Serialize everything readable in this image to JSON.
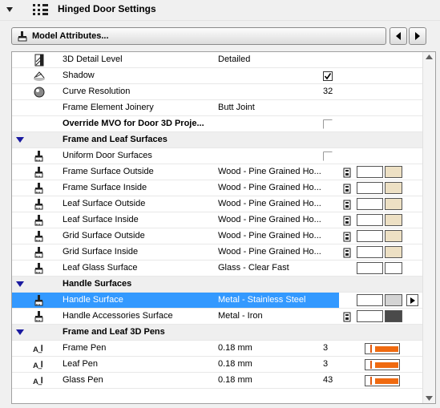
{
  "header": {
    "title": "Hinged Door Settings",
    "icon": "settings-grid-icon"
  },
  "toolbar": {
    "model_label": "Model Attributes..."
  },
  "colors": {
    "selection": "#3399ff",
    "pen": "#f06a10",
    "wood": "#ede0c4",
    "gray": "#d4d4d4",
    "iron": "#4a4a4a"
  },
  "rows": [
    {
      "type": "item",
      "icon": "detail-level-icon",
      "name": "3D Detail Level",
      "value": "Detailed"
    },
    {
      "type": "item",
      "icon": "shadow-icon",
      "name": "Shadow",
      "checked": true
    },
    {
      "type": "item",
      "icon": "sphere-icon",
      "name": "Curve Resolution",
      "num": "32"
    },
    {
      "type": "item",
      "icon": "",
      "name": "Frame Element Joinery",
      "value": "Butt Joint"
    },
    {
      "type": "item",
      "icon": "",
      "name": "Override MVO for Door 3D Proje...",
      "bold": true,
      "checked": false
    },
    {
      "type": "group",
      "name": "Frame and Leaf Surfaces"
    },
    {
      "type": "item",
      "icon": "paint-brush-icon",
      "name": "Uniform Door Surfaces",
      "checked": false
    },
    {
      "type": "item",
      "icon": "paint-brush-icon",
      "name": "Frame Surface Outside",
      "value": "Wood - Pine Grained Ho...",
      "swatch": "wood"
    },
    {
      "type": "item",
      "icon": "paint-brush-icon",
      "name": "Frame Surface Inside",
      "value": "Wood - Pine Grained Ho...",
      "swatch": "wood"
    },
    {
      "type": "item",
      "icon": "paint-brush-icon",
      "name": "Leaf Surface Outside",
      "value": "Wood - Pine Grained Ho...",
      "swatch": "wood"
    },
    {
      "type": "item",
      "icon": "paint-brush-icon",
      "name": "Leaf Surface Inside",
      "value": "Wood - Pine Grained Ho...",
      "swatch": "wood"
    },
    {
      "type": "item",
      "icon": "paint-brush-icon",
      "name": "Grid Surface Outside",
      "value": "Wood - Pine Grained Ho...",
      "swatch": "wood"
    },
    {
      "type": "item",
      "icon": "paint-brush-icon",
      "name": "Grid Surface Inside",
      "value": "Wood - Pine Grained Ho...",
      "swatch": "wood"
    },
    {
      "type": "item",
      "icon": "paint-brush-icon",
      "name": "Leaf Glass Surface",
      "value": "Glass - Clear Fast",
      "swatch": "glass"
    },
    {
      "type": "group",
      "name": "Handle Surfaces"
    },
    {
      "type": "item",
      "icon": "paint-brush-icon",
      "name": "Handle Surface",
      "value": "Metal - Stainless Steel",
      "swatch": "gray",
      "selected": true
    },
    {
      "type": "item",
      "icon": "paint-brush-icon",
      "name": "Handle Accessories Surface",
      "value": "Metal - Iron",
      "swatch": "iron"
    },
    {
      "type": "group",
      "name": "Frame and Leaf 3D Pens"
    },
    {
      "type": "item",
      "icon": "pen-icon",
      "name": "Frame Pen",
      "value": "0.18 mm",
      "num": "3",
      "pen": true
    },
    {
      "type": "item",
      "icon": "pen-icon",
      "name": "Leaf Pen",
      "value": "0.18 mm",
      "num": "3",
      "pen": true
    },
    {
      "type": "item",
      "icon": "pen-icon",
      "name": "Glass Pen",
      "value": "0.18 mm",
      "num": "43",
      "pen": true
    }
  ]
}
